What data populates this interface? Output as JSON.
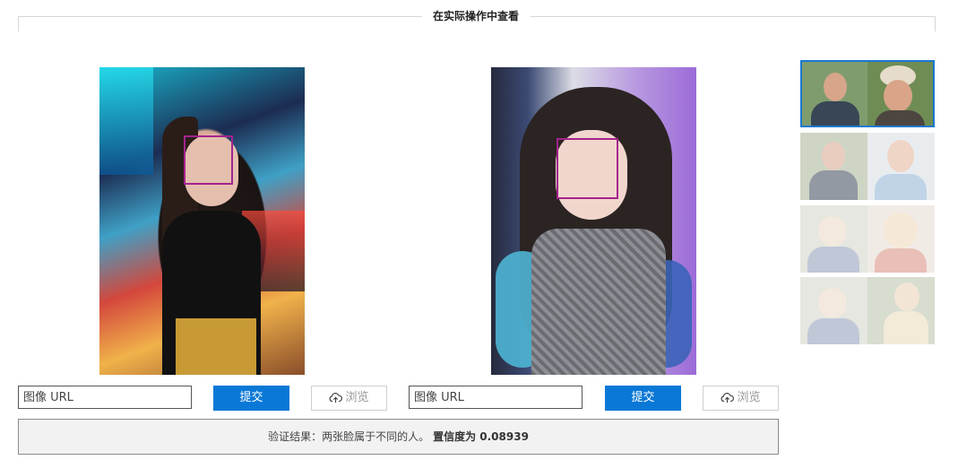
{
  "section": {
    "title": "在实际操作中查看"
  },
  "left": {
    "url_placeholder": "图像 URL",
    "submit_label": "提交",
    "browse_label": "浏览"
  },
  "right": {
    "url_placeholder": "图像 URL",
    "submit_label": "提交",
    "browse_label": "浏览"
  },
  "result": {
    "text": "验证结果：两张脸属于不同的人。",
    "confidence": "置信度为 0.08939"
  },
  "colors": {
    "accent": "#0a78d7",
    "face_box": "#a3238c",
    "selected_border": "#1a78d0"
  },
  "icons": {
    "browse": "cloud-upload-icon"
  },
  "samples": [
    {
      "selected": true
    },
    {
      "selected": false
    },
    {
      "selected": false
    },
    {
      "selected": false
    }
  ]
}
